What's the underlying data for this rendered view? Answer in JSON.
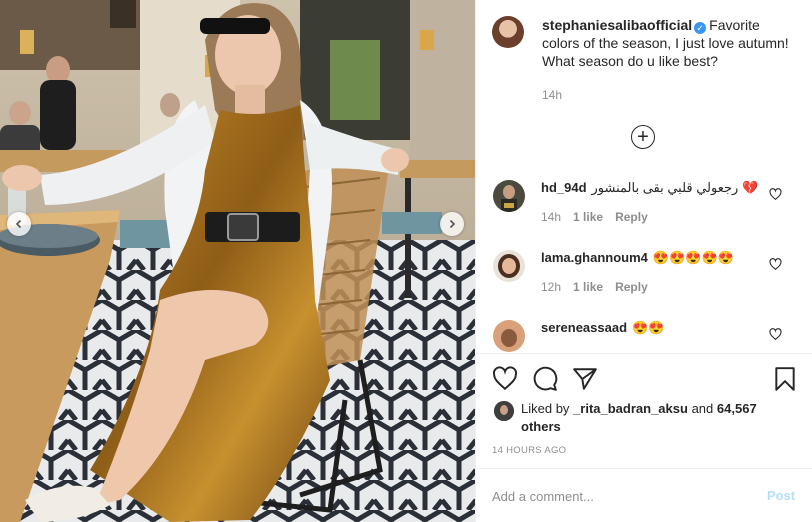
{
  "post": {
    "username": "stephaniesalibaofficial",
    "verified_icon": "verified-badge-icon",
    "caption": "Favorite colors of the season, I just love autumn! What season do u like best?",
    "caption_time": "14h"
  },
  "comments": [
    {
      "username": "hd_94d",
      "text": "رجعولي قلبي بقى بالمنشور 💔",
      "time": "14h",
      "likes": "1 like",
      "reply": "Reply"
    },
    {
      "username": "lama.ghannoum4",
      "text": "😍😍😍😍😍",
      "time": "12h",
      "likes": "1 like",
      "reply": "Reply"
    },
    {
      "username": "sereneassaad",
      "text": "😍😍"
    }
  ],
  "likes": {
    "prefix": "Liked by",
    "user": "_rita_badran_aksu",
    "joiner": "and",
    "others": "64,567 others"
  },
  "timestamp": "14 HOURS AGO",
  "comment_box": {
    "placeholder": "Add a comment...",
    "post_label": "Post"
  },
  "colors": {
    "accent_blue": "#3897f0",
    "post_disabled": "#b2dffc",
    "secondary_text": "#8e8e8e",
    "dress": "#a5701c"
  }
}
